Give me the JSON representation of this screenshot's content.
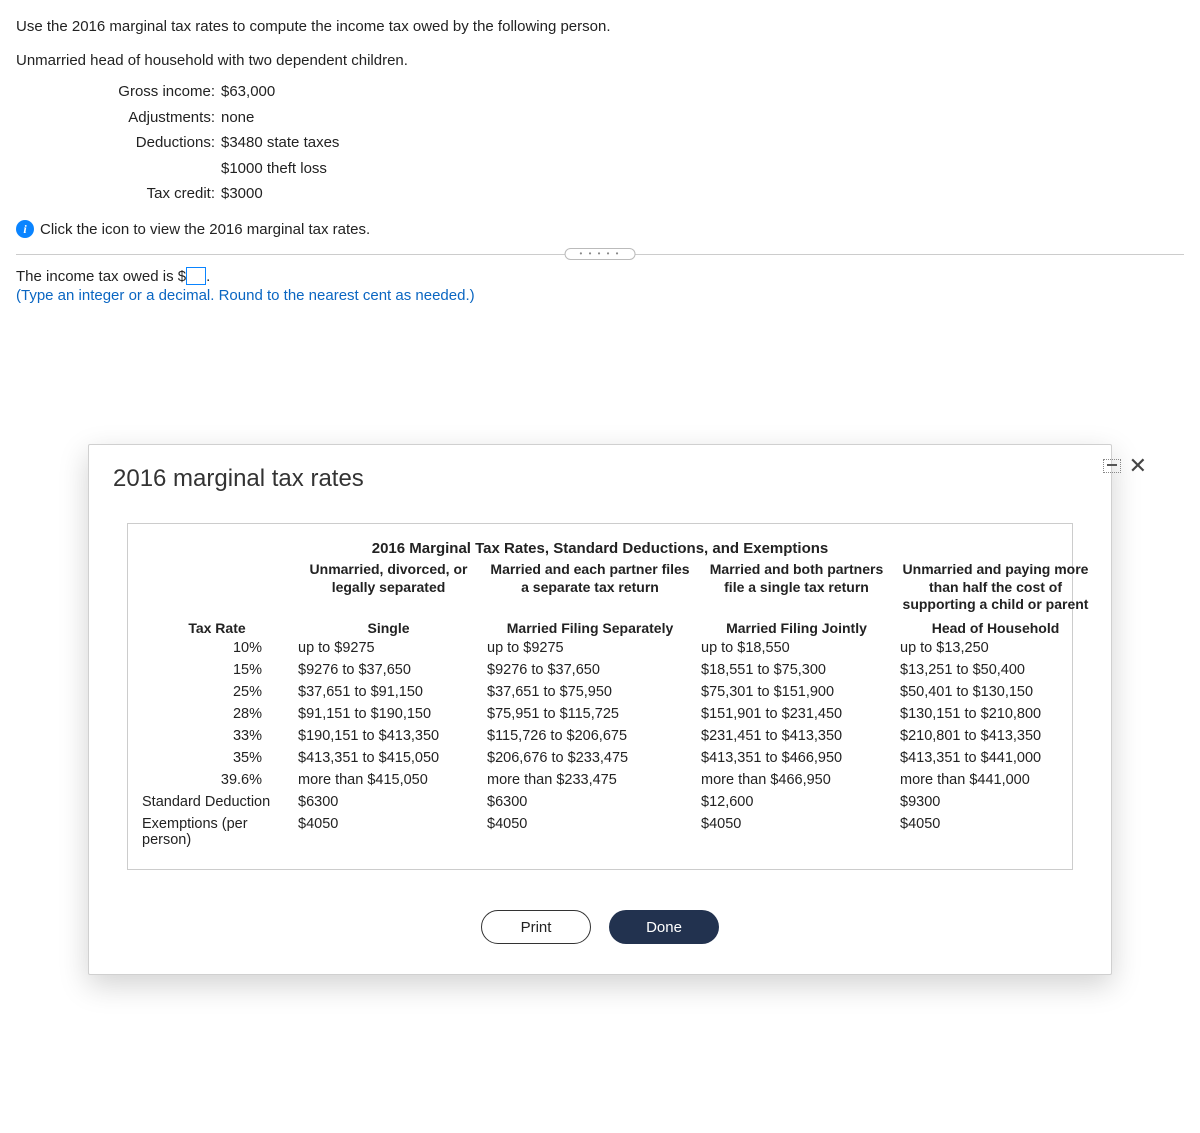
{
  "problem": {
    "intro": "Use the 2016 marginal tax rates to compute the income tax owed by the following person.",
    "status": "Unmarried head of household with two dependent children.",
    "rows": [
      {
        "label": "Gross income:",
        "value": "$63,000"
      },
      {
        "label": "Adjustments:",
        "value": "none"
      },
      {
        "label": "Deductions:",
        "value": "$3480 state taxes"
      },
      {
        "label": "",
        "value": "$1000 theft loss"
      },
      {
        "label": "Tax credit:",
        "value": "$3000"
      }
    ],
    "info_link": "Click the icon to view the 2016 marginal tax rates.",
    "answer_prefix": "The income tax owed is $",
    "answer_suffix": ".",
    "hint": "(Type an integer or a decimal. Round to the nearest cent as needed.)"
  },
  "modal": {
    "title": "2016 marginal tax rates",
    "table_title": "2016 Marginal Tax Rates, Standard Deductions, and Exemptions",
    "desc_headers": [
      "",
      "Unmarried, divorced, or legally separated",
      "Married and each partner files a separate tax return",
      "Married and both partners file a single tax return",
      "Unmarried and paying more than half the cost of supporting a child or parent"
    ],
    "col_headers": [
      "Tax Rate",
      "Single",
      "Married Filing Separately",
      "Married Filing Jointly",
      "Head of Household"
    ],
    "rows": [
      [
        "10%",
        "up to $9275",
        "up to $9275",
        "up to $18,550",
        "up to $13,250"
      ],
      [
        "15%",
        "$9276 to $37,650",
        "$9276 to $37,650",
        "$18,551 to $75,300",
        "$13,251 to $50,400"
      ],
      [
        "25%",
        "$37,651 to $91,150",
        "$37,651 to $75,950",
        "$75,301 to $151,900",
        "$50,401 to $130,150"
      ],
      [
        "28%",
        "$91,151 to $190,150",
        "$75,951 to $115,725",
        "$151,901 to $231,450",
        "$130,151 to $210,800"
      ],
      [
        "33%",
        "$190,151 to $413,350",
        "$115,726 to $206,675",
        "$231,451 to $413,350",
        "$210,801 to $413,350"
      ],
      [
        "35%",
        "$413,351 to $415,050",
        "$206,676 to $233,475",
        "$413,351 to $466,950",
        "$413,351 to $441,000"
      ],
      [
        "39.6%",
        "more than $415,050",
        "more than $233,475",
        "more than $466,950",
        "more than $441,000"
      ]
    ],
    "footer_rows": [
      [
        "Standard Deduction",
        "$6300",
        "$6300",
        "$12,600",
        "$9300"
      ],
      [
        "Exemptions (per person)",
        "$4050",
        "$4050",
        "$4050",
        "$4050"
      ]
    ],
    "print_label": "Print",
    "done_label": "Done"
  }
}
